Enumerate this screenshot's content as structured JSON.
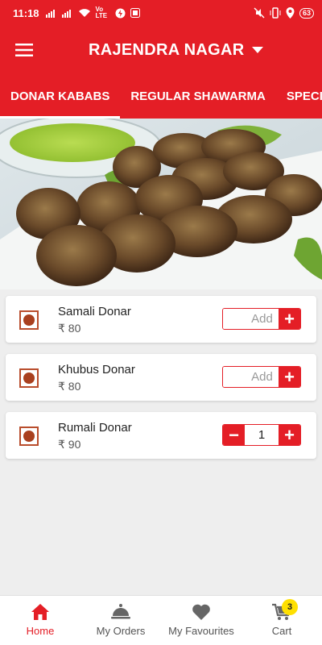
{
  "status_bar": {
    "time": "11:18",
    "network_label": "Vo LTE",
    "battery": "63"
  },
  "header": {
    "location": "RAJENDRA NAGAR"
  },
  "tabs": [
    {
      "label": "DONAR KABABS",
      "active": true
    },
    {
      "label": "REGULAR SHAWARMA",
      "active": false
    },
    {
      "label": "SPECIAL",
      "active": false
    }
  ],
  "items": [
    {
      "name": "Samali Donar",
      "price": "₹ 80",
      "add_label": "Add",
      "plus": "+"
    },
    {
      "name": "Khubus Donar",
      "price": "₹ 80",
      "add_label": "Add",
      "plus": "+"
    },
    {
      "name": "Rumali Donar",
      "price": "₹ 90",
      "quantity": "1",
      "minus": "−",
      "plus": "+"
    }
  ],
  "bottom_nav": [
    {
      "label": "Home",
      "icon": "home-icon",
      "active": true
    },
    {
      "label": "My Orders",
      "icon": "cloche-icon",
      "active": false
    },
    {
      "label": "My Favourites",
      "icon": "heart-icon",
      "active": false
    },
    {
      "label": "Cart",
      "icon": "cart-icon",
      "active": false,
      "badge": "3"
    }
  ],
  "colors": {
    "brand_red": "#e41e26",
    "badge_yellow": "#ffe000",
    "veg_mark_brown": "#a9401f"
  }
}
